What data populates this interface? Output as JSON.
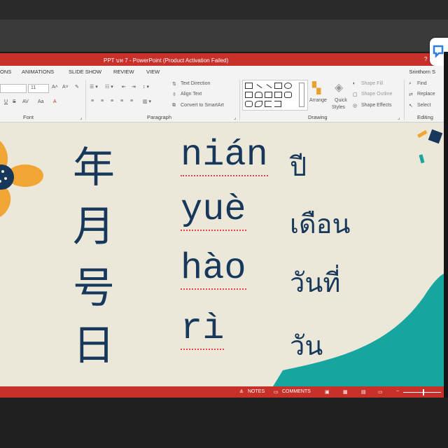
{
  "window": {
    "title": "PPT บท 7 -  PowerPoint (Product Activation Failed)"
  },
  "menu": {
    "tabs": [
      "ONS",
      "ANIMATIONS",
      "SLIDE SHOW",
      "REVIEW",
      "VIEW"
    ],
    "user": "Srinthorn S"
  },
  "ribbon": {
    "font": {
      "size": "11",
      "label": "Font"
    },
    "paragraph": {
      "text_direction": "Text Direction",
      "align_text": "Align Text",
      "convert_smartart": "Convert to SmartArt",
      "label": "Paragraph"
    },
    "drawing": {
      "arrange": "Arrange",
      "quick_styles_1": "Quick",
      "quick_styles_2": "Styles",
      "shape_fill": "Shape Fill",
      "shape_outline": "Shape Outline",
      "shape_effects": "Shape Effects",
      "label": "Drawing"
    },
    "editing": {
      "find": "Find",
      "replace": "Replace",
      "select": "Select",
      "label": "Editing"
    }
  },
  "slide": {
    "rows": [
      {
        "hanzi": "年",
        "pinyin": "nián",
        "thai": "ปี"
      },
      {
        "hanzi": "月",
        "pinyin": "yuè",
        "thai": "เดือน"
      },
      {
        "hanzi": "号",
        "pinyin": "hào",
        "thai": "วันที่"
      },
      {
        "hanzi": "日",
        "pinyin": "rì",
        "thai": "วัน"
      }
    ]
  },
  "status": {
    "notes": "NOTES",
    "comments": "COMMENTS"
  },
  "colors": {
    "accent": "#c8312a",
    "slide_bg": "#ece8d9",
    "text": "#17385a",
    "teal": "#17a59f",
    "orange": "#f0a534"
  }
}
